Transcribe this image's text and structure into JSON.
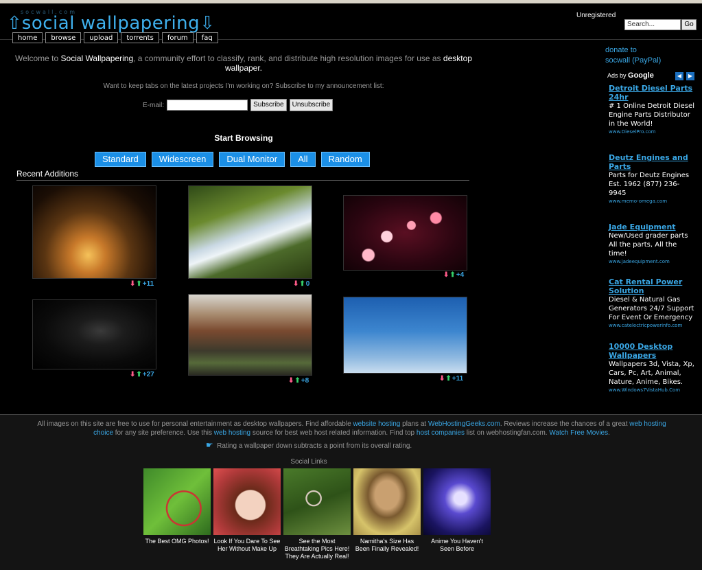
{
  "header": {
    "logo_small": "socwall.com",
    "logo_text": "social wallpapering",
    "nav": [
      "home",
      "browse",
      "upload",
      "torrents",
      "forum",
      "faq"
    ],
    "user_status": "Unregistered",
    "search_placeholder": "Search...",
    "search_button": "Go"
  },
  "welcome": {
    "part1": "Welcome to ",
    "site_name": "Social Wallpapering",
    "part2": ", a community effort to classify, rank, and distribute high resolution images for use as ",
    "highlight": "desktop",
    "part3": " wallpaper."
  },
  "subscribe": {
    "text": "Want to keep tabs on the latest projects I'm working on? Subscribe to my announcement list:",
    "email_label": "E-mail:",
    "subscribe_button": "Subscribe",
    "unsubscribe_button": "Unsubscribe"
  },
  "browsing": {
    "title": "Start Browsing",
    "buttons": [
      "Standard",
      "Widescreen",
      "Dual Monitor",
      "All",
      "Random"
    ]
  },
  "recent": {
    "title": "Recent Additions",
    "items": [
      {
        "rating": "+11",
        "image": "sunset tree"
      },
      {
        "rating": "0",
        "image": "river rapids"
      },
      {
        "rating": "+4",
        "image": "pink bokeh lights"
      },
      {
        "rating": "+27",
        "image": "glowing skull"
      },
      {
        "rating": "+8",
        "image": "industrial plant"
      },
      {
        "rating": "+11",
        "image": "dead tree sky"
      }
    ]
  },
  "sidebar": {
    "donate_line1": "donate to",
    "donate_line2": "socwall (PayPal)",
    "ads_by": "Ads by",
    "ads_brand": "Google",
    "ads": [
      {
        "title": "Detroit Diesel Parts 24hr",
        "body": "# 1 Online Detroit Diesel Engine Parts Distributor in the World!",
        "url": "www.DieselPro.com"
      },
      {
        "title": "Deutz Engines and Parts",
        "body": "Parts for Deutz Engines Est. 1962 (877) 236-9945",
        "url": "www.memo-omega.com"
      },
      {
        "title": "Jade Equipment",
        "body": "New/Used grader parts All the parts, All the time!",
        "url": "www.jadeequipment.com"
      },
      {
        "title": "Cat Rental Power Solution",
        "body": "Diesel & Natural Gas Generators 24/7 Support For Event Or Emergency",
        "url": "www.catelectricpowerinfo.com"
      },
      {
        "title": "10000 Desktop Wallpapers",
        "body": "Wallpapers 3d, Vista, Xp, Cars, Pc, Art, Animal, Nature, Anime, Bikes.",
        "url": "www.Windows7VistaHub.Com"
      }
    ]
  },
  "footer": {
    "t1": "All images on this site are free to use for personal entertainment as desktop wallpapers. Find affordable ",
    "l1": "website hosting",
    "t2": " plans at ",
    "l2": "WebHostingGeeks.com",
    "t3": ". Reviews increase the chances of a great ",
    "l3": "web hosting choice",
    "t4": " for any site preference. Use this ",
    "l4": "web hosting",
    "t5": " source for best web host related information. Find top ",
    "l5": "host companies",
    "t6": " list on webhostingfan.com. ",
    "l6": "Watch Free Movies",
    "t7": ".",
    "rating_note": "Rating a wallpaper down subtracts a point from its overall rating.",
    "social_title": "Social Links",
    "social": [
      "The Best OMG Photos!",
      "Look If You Dare To See Her Without Make Up",
      "See the Most Breathtaking Pics Here! They Are Actually Real!",
      "Namitha's Size Has Been Finally Revealed!",
      "Anime You Haven't Seen Before"
    ]
  }
}
